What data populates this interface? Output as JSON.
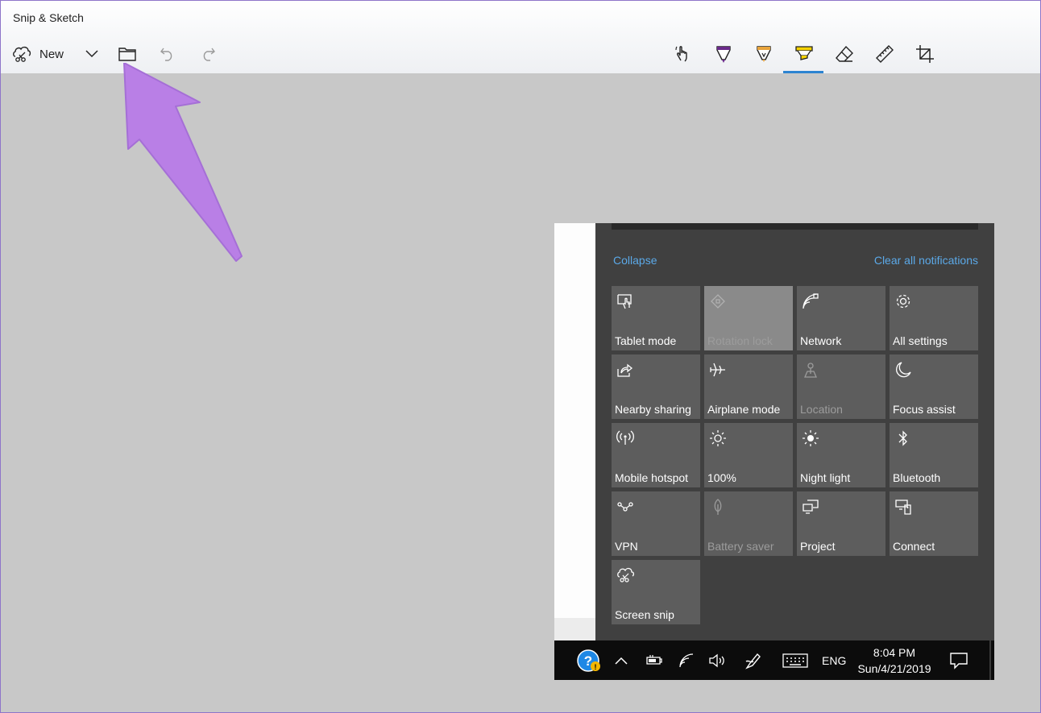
{
  "window": {
    "title": "Snip & Sketch"
  },
  "toolbar": {
    "new_label": "New",
    "icons": [
      "new-snip-icon",
      "chevron-down-icon",
      "open-folder-icon",
      "undo-icon",
      "redo-icon",
      "touch-writing-icon",
      "ballpoint-pen-icon",
      "pencil-icon",
      "highlighter-icon",
      "eraser-icon",
      "ruler-icon",
      "crop-icon"
    ],
    "active_tool": "highlighter"
  },
  "annotation": {
    "arrow_color": "#b97fe6"
  },
  "action_center": {
    "collapse_label": "Collapse",
    "clear_label": "Clear all notifications",
    "tiles": [
      {
        "label": "Tablet mode",
        "icon": "tablet-mode-icon",
        "enabled": true
      },
      {
        "label": "Rotation lock",
        "icon": "rotation-lock-icon",
        "enabled": false
      },
      {
        "label": "Network",
        "icon": "network-icon",
        "enabled": true
      },
      {
        "label": "All settings",
        "icon": "settings-gear-icon",
        "enabled": true
      },
      {
        "label": "Nearby sharing",
        "icon": "nearby-sharing-icon",
        "enabled": true
      },
      {
        "label": "Airplane mode",
        "icon": "airplane-icon",
        "enabled": true
      },
      {
        "label": "Location",
        "icon": "location-icon",
        "enabled": false
      },
      {
        "label": "Focus assist",
        "icon": "moon-icon",
        "enabled": true
      },
      {
        "label": "Mobile hotspot",
        "icon": "hotspot-icon",
        "enabled": true
      },
      {
        "label": "100%",
        "icon": "brightness-icon",
        "enabled": true
      },
      {
        "label": "Night light",
        "icon": "night-light-icon",
        "enabled": true
      },
      {
        "label": "Bluetooth",
        "icon": "bluetooth-icon",
        "enabled": true
      },
      {
        "label": "VPN",
        "icon": "vpn-icon",
        "enabled": true
      },
      {
        "label": "Battery saver",
        "icon": "battery-saver-icon",
        "enabled": false
      },
      {
        "label": "Project",
        "icon": "project-icon",
        "enabled": true
      },
      {
        "label": "Connect",
        "icon": "connect-icon",
        "enabled": true
      },
      {
        "label": "Screen snip",
        "icon": "screen-snip-icon",
        "enabled": true
      }
    ]
  },
  "taskbar": {
    "language": "ENG",
    "time": "8:04 PM",
    "date": "Sun/4/21/2019",
    "icons": [
      "help-icon",
      "show-hidden-icons-chevron",
      "battery-icon",
      "wifi-icon",
      "volume-icon",
      "pen-workspace-icon",
      "touch-keyboard-icon",
      "notifications-icon"
    ]
  },
  "colors": {
    "accent": "#2c84d1",
    "link": "#5ba9e8",
    "tile": "#5d5d5d",
    "panel": "#404040",
    "taskbar": "#0c0c0c"
  }
}
